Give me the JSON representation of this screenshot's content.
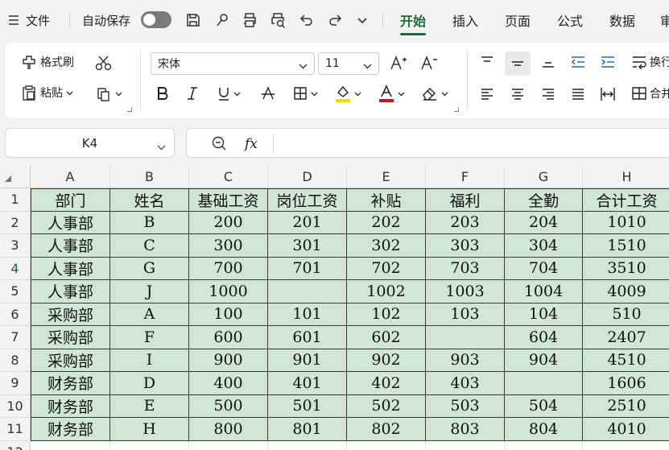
{
  "menubar": {
    "file_label": "文件",
    "autosave_label": "自动保存",
    "tabs": [
      {
        "label": "开始",
        "active": true
      },
      {
        "label": "插入",
        "active": false
      },
      {
        "label": "页面",
        "active": false
      },
      {
        "label": "公式",
        "active": false
      },
      {
        "label": "数据",
        "active": false
      },
      {
        "label": "审",
        "active": false
      }
    ],
    "accent_color": "#1b6b3a"
  },
  "ribbon": {
    "format_painter_label": "格式刷",
    "paste_label": "粘贴",
    "font_name": "宋体",
    "font_size": "11",
    "wrap_label": "换行",
    "merge_label": "合并"
  },
  "formula_bar": {
    "cell_ref": "K4",
    "fx_label": "fx",
    "formula_value": ""
  },
  "sheet": {
    "columns": [
      "A",
      "B",
      "C",
      "D",
      "E",
      "F",
      "G",
      "H"
    ],
    "row_numbers": [
      "1",
      "2",
      "3",
      "4",
      "5",
      "6",
      "7",
      "8",
      "9",
      "10",
      "11",
      "12"
    ],
    "fill_color": "#cfe7d3",
    "rows": [
      [
        "部门",
        "姓名",
        "基础工资",
        "岗位工资",
        "补贴",
        "福利",
        "全勤",
        "合计工资"
      ],
      [
        "人事部",
        "B",
        "200",
        "201",
        "202",
        "203",
        "204",
        "1010"
      ],
      [
        "人事部",
        "C",
        "300",
        "301",
        "302",
        "303",
        "304",
        "1510"
      ],
      [
        "人事部",
        "G",
        "700",
        "701",
        "702",
        "703",
        "704",
        "3510"
      ],
      [
        "人事部",
        "J",
        "1000",
        "",
        "1002",
        "1003",
        "1004",
        "4009"
      ],
      [
        "采购部",
        "A",
        "100",
        "101",
        "102",
        "103",
        "104",
        "510"
      ],
      [
        "采购部",
        "F",
        "600",
        "601",
        "602",
        "",
        "604",
        "2407"
      ],
      [
        "采购部",
        "I",
        "900",
        "901",
        "902",
        "903",
        "904",
        "4510"
      ],
      [
        "财务部",
        "D",
        "400",
        "401",
        "402",
        "403",
        "",
        "1606"
      ],
      [
        "财务部",
        "E",
        "500",
        "501",
        "502",
        "503",
        "504",
        "2510"
      ],
      [
        "财务部",
        "H",
        "800",
        "801",
        "802",
        "803",
        "804",
        "4010"
      ]
    ]
  }
}
